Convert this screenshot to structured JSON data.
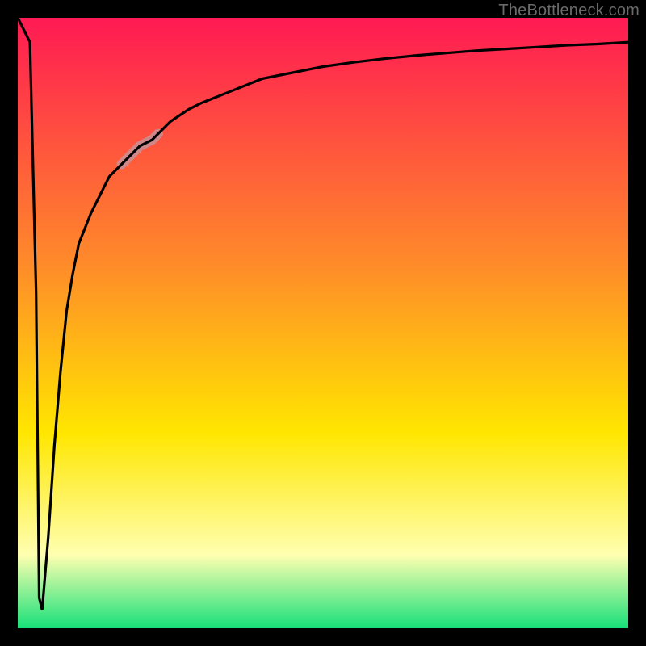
{
  "watermark": "TheBottleneck.com",
  "colors": {
    "gradient_top": "#ff1a53",
    "gradient_mid1": "#ff8a2a",
    "gradient_mid2": "#ffe600",
    "gradient_mid3": "#ffffb0",
    "gradient_bottom": "#17e07a",
    "curve": "#000000",
    "highlight": "#c98e92",
    "frame": "#000000"
  },
  "chart_data": {
    "type": "line",
    "title": "",
    "xlabel": "",
    "ylabel": "",
    "xlim": [
      0,
      100
    ],
    "ylim": [
      0,
      100
    ],
    "grid": false,
    "legend": false,
    "series": [
      {
        "name": "bottleneck-curve",
        "x": [
          0,
          2,
          3,
          3.5,
          4,
          5,
          6,
          7,
          8,
          9,
          10,
          12,
          15,
          18,
          20,
          22,
          25,
          28,
          30,
          35,
          40,
          45,
          50,
          55,
          60,
          65,
          70,
          75,
          80,
          85,
          90,
          95,
          100
        ],
        "y": [
          100,
          96,
          55,
          5,
          3,
          15,
          30,
          42,
          52,
          58,
          63,
          68,
          74,
          77,
          79,
          80,
          83,
          85,
          86,
          88,
          90,
          91,
          92,
          92.7,
          93.3,
          93.8,
          94.2,
          94.6,
          94.9,
          95.2,
          95.5,
          95.7,
          96
        ]
      }
    ],
    "highlight_segment": {
      "series": "bottleneck-curve",
      "x_start": 17,
      "x_end": 23
    }
  }
}
